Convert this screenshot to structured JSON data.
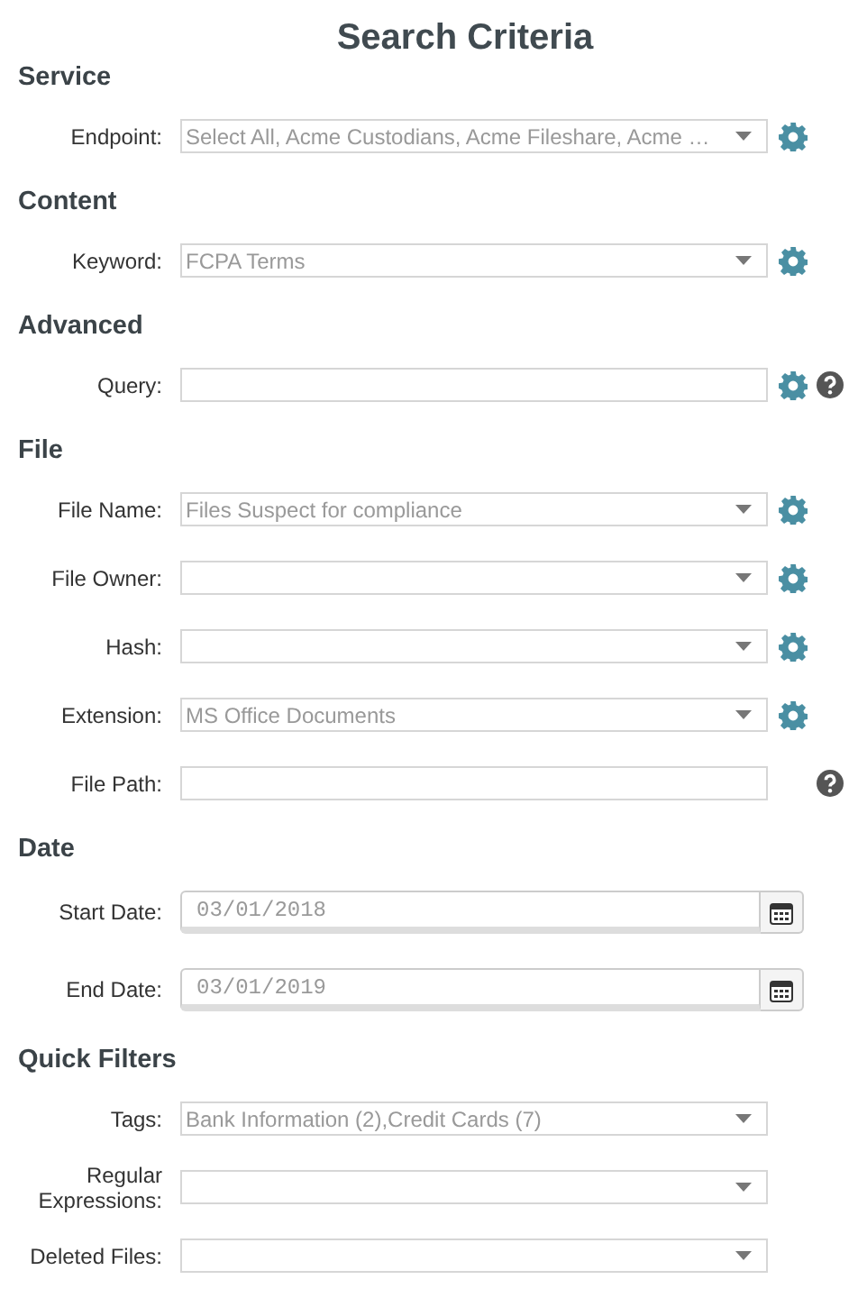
{
  "title": "Search Criteria",
  "sections": [
    {
      "heading": "Service",
      "fields": [
        {
          "kind": "select",
          "label": "Endpoint:",
          "value": "Select All, Acme Custodians, Acme Fileshare, Acme …",
          "settings": true,
          "help": false
        }
      ]
    },
    {
      "heading": "Content",
      "fields": [
        {
          "kind": "select",
          "label": "Keyword:",
          "value": "FCPA Terms",
          "settings": true,
          "help": false
        }
      ]
    },
    {
      "heading": "Advanced",
      "fields": [
        {
          "kind": "text",
          "label": "Query:",
          "settings": true,
          "help": true
        }
      ]
    },
    {
      "heading": "File",
      "fields": [
        {
          "kind": "select",
          "label": "File Name:",
          "value": "Files Suspect for compliance",
          "settings": true,
          "help": false
        },
        {
          "kind": "select",
          "label": "File Owner:",
          "settings": true,
          "help": false
        },
        {
          "kind": "select",
          "label": "Hash:",
          "settings": true,
          "help": false
        },
        {
          "kind": "select",
          "label": "Extension:",
          "value": "MS Office Documents",
          "settings": true,
          "help": false
        },
        {
          "kind": "text",
          "label": "File Path:",
          "settings": false,
          "help": true
        }
      ]
    },
    {
      "heading": "Date",
      "fields": [
        {
          "kind": "date",
          "label": "Start Date:",
          "value": "03/01/2018"
        },
        {
          "kind": "date",
          "label": "End Date:",
          "value": "03/01/2019"
        }
      ]
    },
    {
      "heading": "Quick Filters",
      "fields": [
        {
          "kind": "select",
          "label": "Tags:",
          "value": "Bank Information (2),Credit Cards (7)",
          "settings": false,
          "help": false
        },
        {
          "kind": "select",
          "label": "Regular Expressions:",
          "settings": false,
          "help": false
        },
        {
          "kind": "select",
          "label": "Deleted Files:",
          "settings": false,
          "help": false
        }
      ]
    }
  ]
}
